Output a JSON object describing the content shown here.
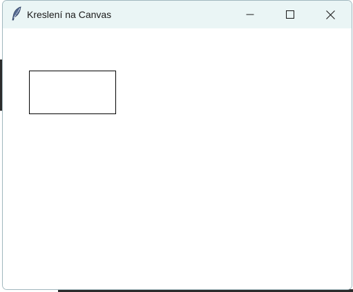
{
  "window": {
    "title": "Kreslení na Canvas",
    "app_icon": "feather-icon"
  },
  "controls": {
    "minimize_icon": "minimize-icon",
    "maximize_icon": "maximize-icon",
    "close_icon": "close-icon"
  },
  "canvas": {
    "background": "#ffffff",
    "shapes": [
      {
        "type": "rectangle",
        "outline": "#000000",
        "fill": "none"
      }
    ]
  }
}
